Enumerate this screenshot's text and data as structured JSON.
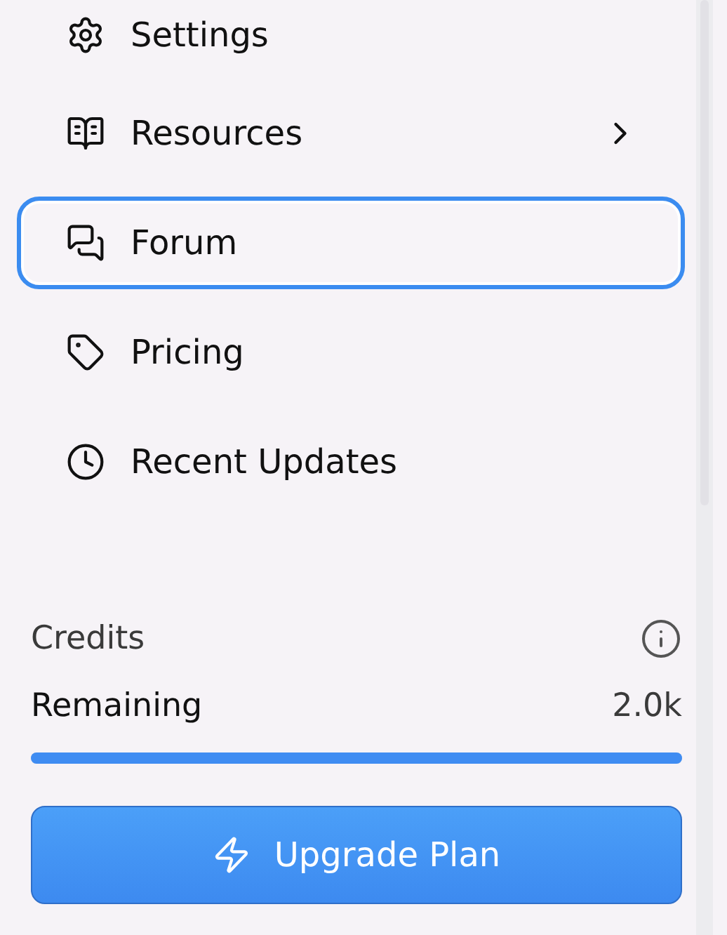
{
  "nav_items": [
    {
      "label": "Settings",
      "selected": false,
      "has_submenu": false
    },
    {
      "label": "Resources",
      "selected": false,
      "has_submenu": true
    },
    {
      "label": "Forum",
      "selected": true,
      "has_submenu": false
    },
    {
      "label": "Pricing",
      "selected": false,
      "has_submenu": false
    },
    {
      "label": "Recent Updates",
      "selected": false,
      "has_submenu": false
    }
  ],
  "credits": {
    "title": "Credits",
    "label": "Remaining",
    "value": "2.0k",
    "level": 1
  },
  "upgrade_button": {
    "label": "Upgrade Plan"
  }
}
